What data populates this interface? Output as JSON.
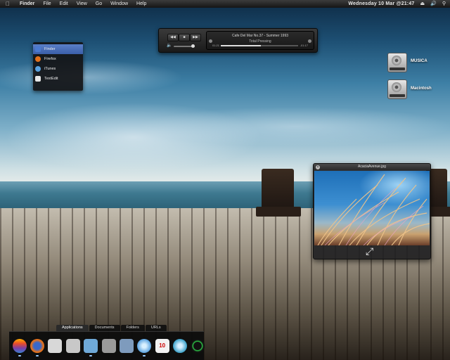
{
  "menubar": {
    "apple_icon": "apple-icon",
    "items": [
      {
        "label": "Finder",
        "bold": true
      },
      {
        "label": "File"
      },
      {
        "label": "Edit"
      },
      {
        "label": "View"
      },
      {
        "label": "Go"
      },
      {
        "label": "Window"
      },
      {
        "label": "Help"
      }
    ],
    "clock": "Wednesday 10 Mar @21:47",
    "status_icons": [
      "eject-icon",
      "volume-icon",
      "search-icon"
    ]
  },
  "switcher": {
    "items": [
      {
        "label": "Finder",
        "active": true,
        "icon": "finder-icon",
        "color": "#4a7ad0"
      },
      {
        "label": "Firefox",
        "active": false,
        "icon": "firefox-icon",
        "color": "#e2711d"
      },
      {
        "label": "iTunes",
        "active": false,
        "icon": "itunes-icon",
        "color": "#5aa2e0"
      },
      {
        "label": "TextEdit",
        "active": false,
        "icon": "textedit-icon",
        "color": "#e8e8e8"
      }
    ]
  },
  "player": {
    "track": "Cafe Del Mar No.37 - Summer 1993",
    "album": "Total Pressing",
    "elapsed": "01:21",
    "remaining": "-01:17",
    "progress": 0.52,
    "volume": 0.85,
    "controls": [
      "previous-icon",
      "stop-icon",
      "next-icon"
    ]
  },
  "desktop_icons": [
    {
      "label": "MUSICA",
      "icon": "hard-drive-icon"
    },
    {
      "label": "Macintosh",
      "icon": "hard-drive-icon"
    }
  ],
  "preview": {
    "title": "AcaciaAvenue.jpg",
    "close_icon": "close-icon",
    "expand_icon": "fullscreen-icon"
  },
  "dock": {
    "tabs": [
      {
        "label": "Applications",
        "active": true
      },
      {
        "label": "Documents",
        "active": false
      },
      {
        "label": "Folders",
        "active": false
      },
      {
        "label": "URLs",
        "active": false
      }
    ],
    "items": [
      {
        "name": "finder-icon",
        "color": "#e86b2a",
        "glyph": "",
        "running": true
      },
      {
        "name": "firefox-icon",
        "color": "#e2711d",
        "glyph": "",
        "running": true
      },
      {
        "name": "mail-icon",
        "color": "#d8d8d8",
        "glyph": "",
        "running": false
      },
      {
        "name": "document-icon",
        "color": "#c8c8c8",
        "glyph": "",
        "running": false
      },
      {
        "name": "preview-icon",
        "color": "#6fa9d8",
        "glyph": "",
        "running": true
      },
      {
        "name": "camera-icon",
        "color": "#9a9a9a",
        "glyph": "",
        "running": false
      },
      {
        "name": "photo-icon",
        "color": "#7e9bbd",
        "glyph": "",
        "running": false
      },
      {
        "name": "itunes-icon",
        "color": "#5aa2e0",
        "glyph": "",
        "running": true
      },
      {
        "name": "calendar-icon",
        "color": "#f2f2f2",
        "glyph": "10",
        "running": false
      },
      {
        "name": "globe-icon",
        "color": "#3aa0c8",
        "glyph": "",
        "running": false
      },
      {
        "name": "power-icon",
        "color": "#2a2a2a",
        "glyph": "",
        "running": false
      }
    ]
  }
}
